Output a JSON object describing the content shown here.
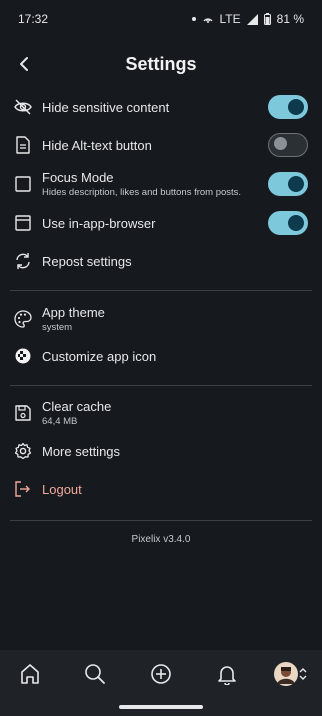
{
  "status_bar": {
    "time": "17:32",
    "network": "LTE",
    "battery": "81 %"
  },
  "header": {
    "title": "Settings"
  },
  "items": {
    "hide_sensitive": {
      "label": "Hide sensitive content",
      "toggle": true
    },
    "hide_alt": {
      "label": "Hide Alt-text button",
      "toggle": false
    },
    "focus_mode": {
      "label": "Focus Mode",
      "sub": "Hides description, likes and buttons from posts.",
      "toggle": true
    },
    "in_app_browser": {
      "label": "Use in-app-browser",
      "toggle": true
    },
    "repost": {
      "label": "Repost settings"
    },
    "app_theme": {
      "label": "App theme",
      "sub": "system"
    },
    "app_icon": {
      "label": "Customize app icon"
    },
    "clear_cache": {
      "label": "Clear cache",
      "sub": "64,4 MB"
    },
    "more_settings": {
      "label": "More settings"
    },
    "logout": {
      "label": "Logout"
    }
  },
  "footer": {
    "version": "Pixelix v3.4.0"
  },
  "bottom_nav": {
    "items": [
      "home-icon",
      "search-icon",
      "compose-icon",
      "notifications-icon",
      "profile-avatar"
    ]
  },
  "colors": {
    "accent": "#7ec8dc",
    "background": "#16191d",
    "logout": "#f0a89b"
  }
}
